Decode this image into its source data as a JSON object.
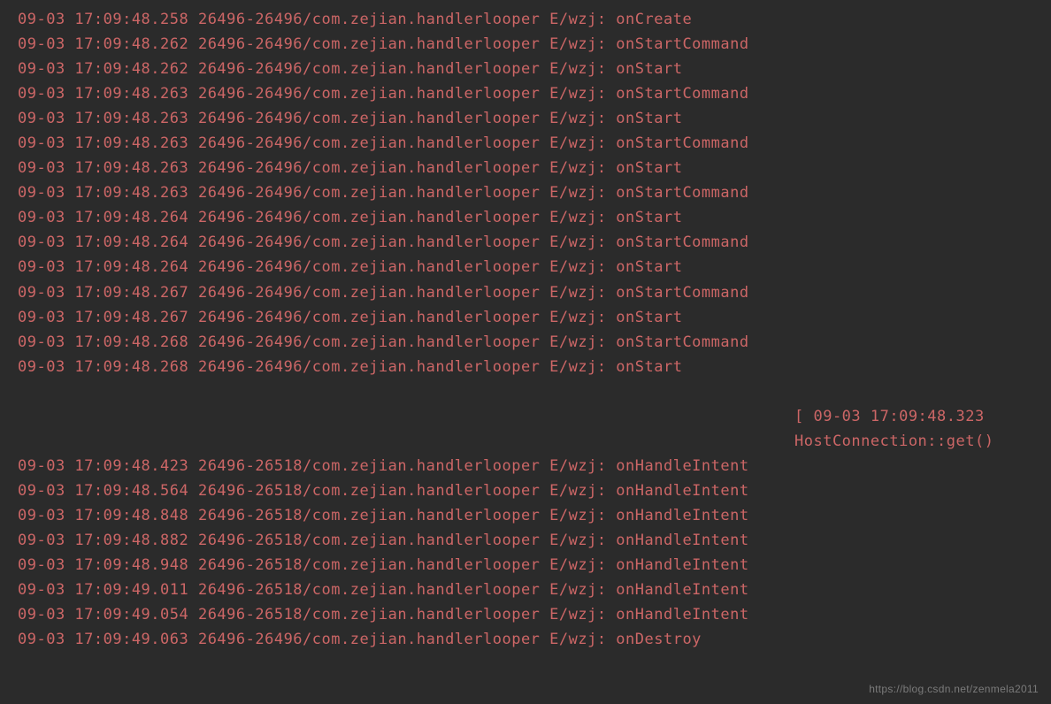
{
  "log_entries": [
    {
      "date": "09-03",
      "time": "17:09:48.258",
      "pid_tid": "26496-26496",
      "package": "com.zejian.handlerlooper",
      "level": "E",
      "tag": "wzj",
      "message": "onCreate"
    },
    {
      "date": "09-03",
      "time": "17:09:48.262",
      "pid_tid": "26496-26496",
      "package": "com.zejian.handlerlooper",
      "level": "E",
      "tag": "wzj",
      "message": "onStartCommand"
    },
    {
      "date": "09-03",
      "time": "17:09:48.262",
      "pid_tid": "26496-26496",
      "package": "com.zejian.handlerlooper",
      "level": "E",
      "tag": "wzj",
      "message": "onStart"
    },
    {
      "date": "09-03",
      "time": "17:09:48.263",
      "pid_tid": "26496-26496",
      "package": "com.zejian.handlerlooper",
      "level": "E",
      "tag": "wzj",
      "message": "onStartCommand"
    },
    {
      "date": "09-03",
      "time": "17:09:48.263",
      "pid_tid": "26496-26496",
      "package": "com.zejian.handlerlooper",
      "level": "E",
      "tag": "wzj",
      "message": "onStart"
    },
    {
      "date": "09-03",
      "time": "17:09:48.263",
      "pid_tid": "26496-26496",
      "package": "com.zejian.handlerlooper",
      "level": "E",
      "tag": "wzj",
      "message": "onStartCommand"
    },
    {
      "date": "09-03",
      "time": "17:09:48.263",
      "pid_tid": "26496-26496",
      "package": "com.zejian.handlerlooper",
      "level": "E",
      "tag": "wzj",
      "message": "onStart"
    },
    {
      "date": "09-03",
      "time": "17:09:48.263",
      "pid_tid": "26496-26496",
      "package": "com.zejian.handlerlooper",
      "level": "E",
      "tag": "wzj",
      "message": "onStartCommand"
    },
    {
      "date": "09-03",
      "time": "17:09:48.264",
      "pid_tid": "26496-26496",
      "package": "com.zejian.handlerlooper",
      "level": "E",
      "tag": "wzj",
      "message": "onStart"
    },
    {
      "date": "09-03",
      "time": "17:09:48.264",
      "pid_tid": "26496-26496",
      "package": "com.zejian.handlerlooper",
      "level": "E",
      "tag": "wzj",
      "message": "onStartCommand"
    },
    {
      "date": "09-03",
      "time": "17:09:48.264",
      "pid_tid": "26496-26496",
      "package": "com.zejian.handlerlooper",
      "level": "E",
      "tag": "wzj",
      "message": "onStart"
    },
    {
      "date": "09-03",
      "time": "17:09:48.267",
      "pid_tid": "26496-26496",
      "package": "com.zejian.handlerlooper",
      "level": "E",
      "tag": "wzj",
      "message": "onStartCommand"
    },
    {
      "date": "09-03",
      "time": "17:09:48.267",
      "pid_tid": "26496-26496",
      "package": "com.zejian.handlerlooper",
      "level": "E",
      "tag": "wzj",
      "message": "onStart"
    },
    {
      "date": "09-03",
      "time": "17:09:48.268",
      "pid_tid": "26496-26496",
      "package": "com.zejian.handlerlooper",
      "level": "E",
      "tag": "wzj",
      "message": "onStartCommand"
    },
    {
      "date": "09-03",
      "time": "17:09:48.268",
      "pid_tid": "26496-26496",
      "package": "com.zejian.handlerlooper",
      "level": "E",
      "tag": "wzj",
      "message": "onStart"
    }
  ],
  "partial_lines": [
    "[ 09-03 17:09:48.323",
    "HostConnection::get()"
  ],
  "log_entries_after": [
    {
      "date": "09-03",
      "time": "17:09:48.423",
      "pid_tid": "26496-26518",
      "package": "com.zejian.handlerlooper",
      "level": "E",
      "tag": "wzj",
      "message": "onHandleIntent"
    },
    {
      "date": "09-03",
      "time": "17:09:48.564",
      "pid_tid": "26496-26518",
      "package": "com.zejian.handlerlooper",
      "level": "E",
      "tag": "wzj",
      "message": "onHandleIntent"
    },
    {
      "date": "09-03",
      "time": "17:09:48.848",
      "pid_tid": "26496-26518",
      "package": "com.zejian.handlerlooper",
      "level": "E",
      "tag": "wzj",
      "message": "onHandleIntent"
    },
    {
      "date": "09-03",
      "time": "17:09:48.882",
      "pid_tid": "26496-26518",
      "package": "com.zejian.handlerlooper",
      "level": "E",
      "tag": "wzj",
      "message": "onHandleIntent"
    },
    {
      "date": "09-03",
      "time": "17:09:48.948",
      "pid_tid": "26496-26518",
      "package": "com.zejian.handlerlooper",
      "level": "E",
      "tag": "wzj",
      "message": "onHandleIntent"
    },
    {
      "date": "09-03",
      "time": "17:09:49.011",
      "pid_tid": "26496-26518",
      "package": "com.zejian.handlerlooper",
      "level": "E",
      "tag": "wzj",
      "message": "onHandleIntent"
    },
    {
      "date": "09-03",
      "time": "17:09:49.054",
      "pid_tid": "26496-26518",
      "package": "com.zejian.handlerlooper",
      "level": "E",
      "tag": "wzj",
      "message": "onHandleIntent"
    },
    {
      "date": "09-03",
      "time": "17:09:49.063",
      "pid_tid": "26496-26496",
      "package": "com.zejian.handlerlooper",
      "level": "E",
      "tag": "wzj",
      "message": "onDestroy"
    }
  ],
  "watermark": "https://blog.csdn.net/zenmela2011"
}
